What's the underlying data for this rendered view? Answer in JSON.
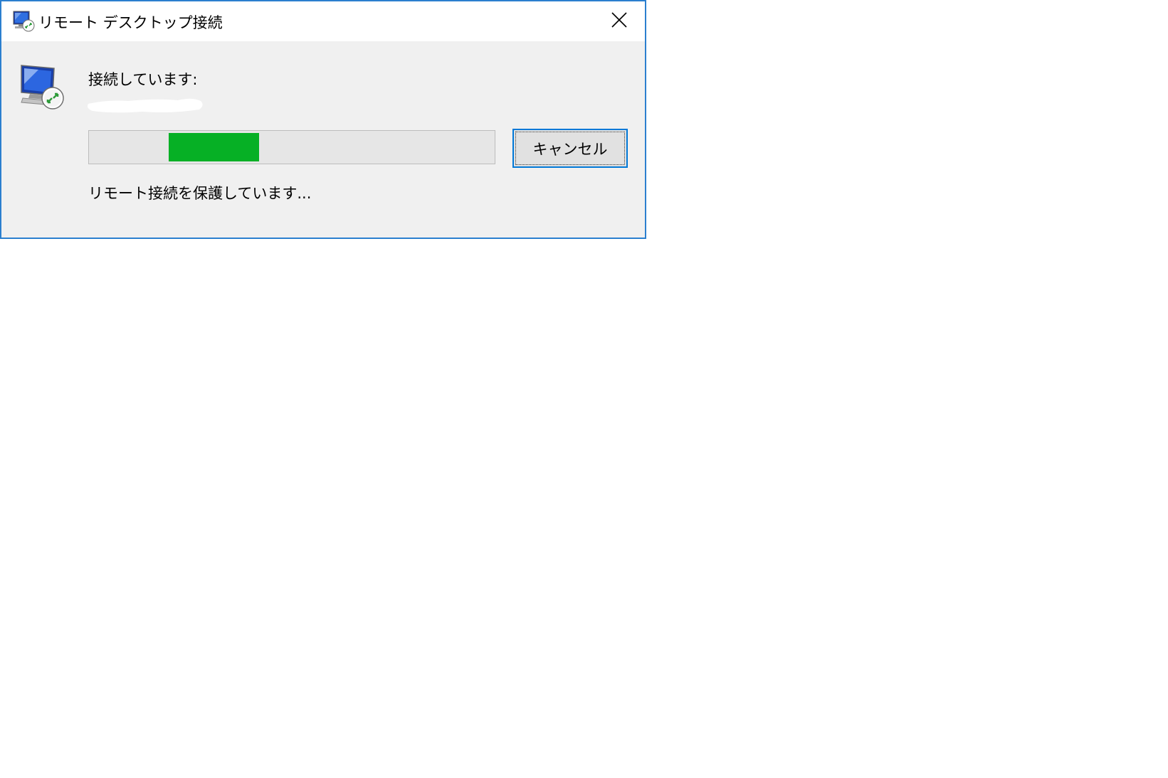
{
  "window": {
    "title": "リモート デスクトップ接続",
    "accent_color": "#2b7fcf"
  },
  "icons": {
    "app": "remote-desktop-icon",
    "close": "close-icon"
  },
  "dialog": {
    "connecting_label": "接続しています:",
    "server_name": "",
    "progress": {
      "state": "indeterminate",
      "fill_color": "#06b025"
    },
    "cancel_label": "キャンセル",
    "status": "リモート接続を保護しています..."
  }
}
